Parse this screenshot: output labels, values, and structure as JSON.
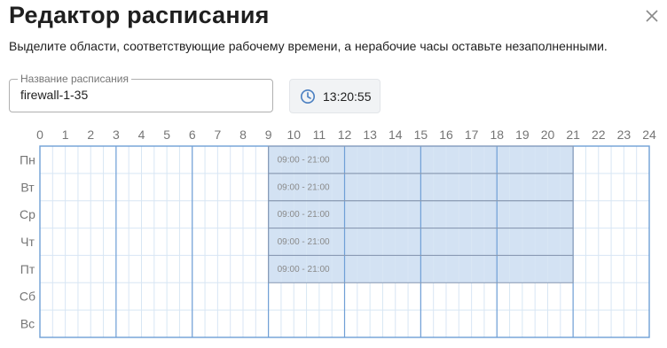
{
  "dialog": {
    "title": "Редактор расписания",
    "subtitle": "Выделите области, соответствующие рабочему времени, а нерабочие часы оставьте незаполненными.",
    "close_icon": "close-icon"
  },
  "schedule_name": {
    "label": "Название расписания",
    "value": "firewall-1-35"
  },
  "clock": {
    "icon": "clock-icon",
    "time": "13:20:55"
  },
  "grid": {
    "hours": [
      "0",
      "1",
      "2",
      "3",
      "4",
      "5",
      "6",
      "7",
      "8",
      "9",
      "10",
      "11",
      "12",
      "13",
      "14",
      "15",
      "16",
      "17",
      "18",
      "19",
      "20",
      "21",
      "22",
      "23",
      "24"
    ],
    "days": [
      "Пн",
      "Вт",
      "Ср",
      "Чт",
      "Пт",
      "Сб",
      "Вс"
    ],
    "selections": [
      {
        "day": 0,
        "start": 9,
        "end": 21,
        "label": "09:00 - 21:00"
      },
      {
        "day": 1,
        "start": 9,
        "end": 21,
        "label": "09:00 - 21:00"
      },
      {
        "day": 2,
        "start": 9,
        "end": 21,
        "label": "09:00 - 21:00"
      },
      {
        "day": 3,
        "start": 9,
        "end": 21,
        "label": "09:00 - 21:00"
      },
      {
        "day": 4,
        "start": 9,
        "end": 21,
        "label": "09:00 - 21:00"
      }
    ],
    "colors": {
      "selection_fill": "#d3e2f3",
      "selection_border": "#8a9ab3",
      "grid_line": "#d8e6f4",
      "major_line": "#6f9fd6",
      "axis_text": "#757575"
    }
  }
}
